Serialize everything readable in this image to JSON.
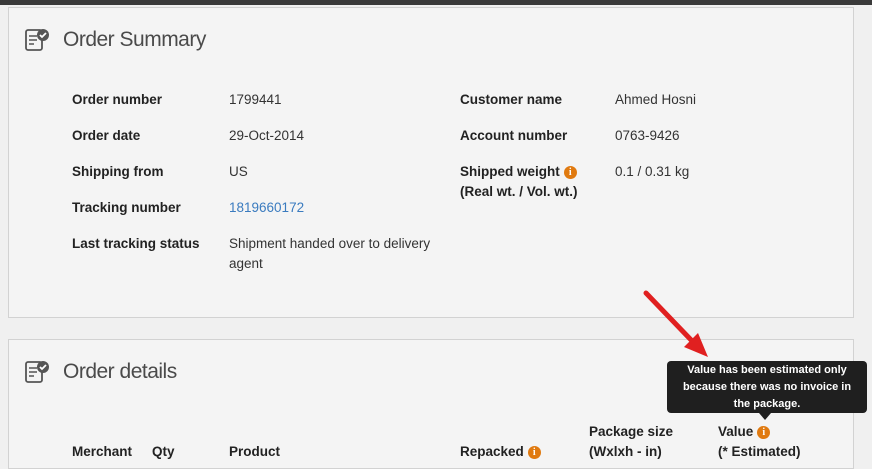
{
  "order_summary": {
    "title": "Order Summary",
    "left_fields": [
      {
        "label": "Order number",
        "value": "1799441"
      },
      {
        "label": "Order date",
        "value": "29-Oct-2014"
      },
      {
        "label": "Shipping from",
        "value": "US"
      },
      {
        "label": "Tracking number",
        "value": "1819660172"
      },
      {
        "label": "Last tracking status",
        "value_line1": "Shipment handed over to delivery",
        "value_line2": "agent"
      }
    ],
    "right_fields": [
      {
        "label": "Customer name",
        "value": "Ahmed Hosni"
      },
      {
        "label": "Account number",
        "value": "0763-9426"
      },
      {
        "label": "Shipped weight",
        "label_line2": "(Real wt. / Vol. wt.)",
        "value": "0.1 / 0.31 kg"
      }
    ]
  },
  "order_details": {
    "title": "Order details",
    "columns": {
      "merchant": "Merchant",
      "qty": "Qty",
      "product": "Product",
      "repacked": "Repacked",
      "package_size_line1": "Package size",
      "package_size_line2": "(Wxlxh - in)",
      "value_line1": "Value",
      "value_line2": "(* Estimated)"
    }
  },
  "tooltip": {
    "line1": "Value has been estimated only",
    "line2": "because there was no invoice in",
    "line3": "the package."
  },
  "icons": {
    "panel_icon": "document-check-icon",
    "info_icon": "info-icon",
    "annotation": "red-arrow"
  },
  "colors": {
    "accent_orange": "#e07a10",
    "link_blue": "#3a7bbf",
    "arrow_red": "#e02020"
  }
}
